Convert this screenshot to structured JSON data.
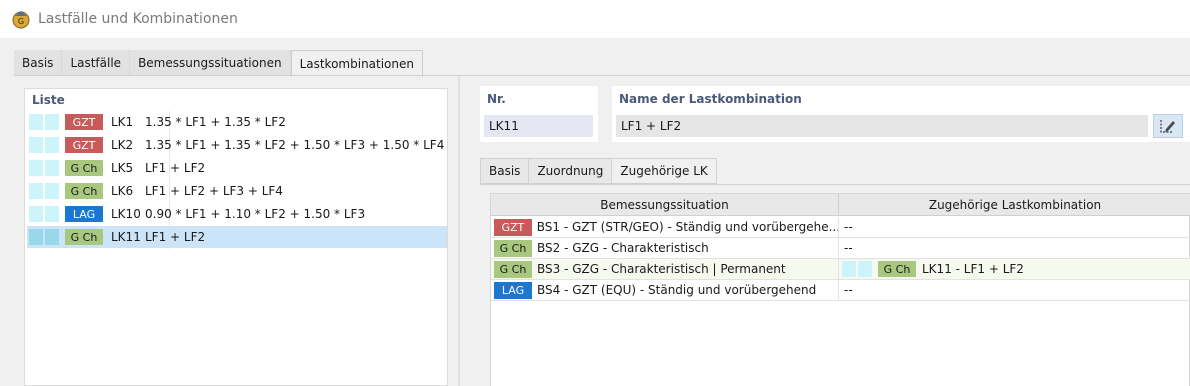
{
  "window": {
    "title": "Lastfälle und Kombinationen"
  },
  "main_tabs": [
    {
      "label": "Basis"
    },
    {
      "label": "Lastfälle"
    },
    {
      "label": "Bemessungssituationen"
    },
    {
      "label": "Lastkombinationen",
      "active": true
    }
  ],
  "list": {
    "header": "Liste",
    "rows": [
      {
        "badge": "GZT",
        "color": "#c85a5a",
        "id": "LK1",
        "formula": "1.35 * LF1 + 1.35 * LF2"
      },
      {
        "badge": "GZT",
        "color": "#c85a5a",
        "id": "LK2",
        "formula": "1.35 * LF1 + 1.35 * LF2 + 1.50 * LF3 + 1.50 * LF4"
      },
      {
        "badge": "G Ch",
        "color": "#a8c880",
        "id": "LK5",
        "formula": "LF1 + LF2"
      },
      {
        "badge": "G Ch",
        "color": "#a8c880",
        "id": "LK6",
        "formula": "LF1 + LF2 + LF3 + LF4"
      },
      {
        "badge": "LAG",
        "color": "#1c77d0",
        "id": "LK10",
        "formula": "0.90 * LF1 + 1.10 * LF2 + 1.50 * LF3"
      },
      {
        "badge": "G Ch",
        "color": "#a8c880",
        "id": "LK11",
        "formula": "LF1 + LF2",
        "selected": true
      }
    ]
  },
  "nr": {
    "label": "Nr.",
    "value": "LK11"
  },
  "name": {
    "label": "Name der Lastkombination",
    "value": "LF1 + LF2"
  },
  "sub_tabs": [
    {
      "label": "Basis"
    },
    {
      "label": "Zuordnung"
    },
    {
      "label": "Zugehörige LK",
      "active": true
    }
  ],
  "grid": {
    "headers": [
      "Bemessungssituation",
      "Zugehörige Lastkombination"
    ],
    "rows": [
      {
        "badge": "GZT",
        "color": "#c85a5a",
        "situation": "BS1 - GZT (STR/GEO) - Ständig und vorübergehe...",
        "combo": "--"
      },
      {
        "badge": "G Ch",
        "color": "#a8c880",
        "situation": "BS2 - GZG - Charakteristisch",
        "combo": "--"
      },
      {
        "badge": "G Ch",
        "color": "#a8c880",
        "situation": "BS3 - GZG - Charakteristisch | Permanent",
        "combo_badge": "G Ch",
        "combo": "LK11 - LF1 + LF2"
      },
      {
        "badge": "LAG",
        "color": "#1c77d0",
        "situation": "BS4 - GZT (EQU) - Ständig und vorübergehend",
        "combo": "--"
      }
    ]
  }
}
